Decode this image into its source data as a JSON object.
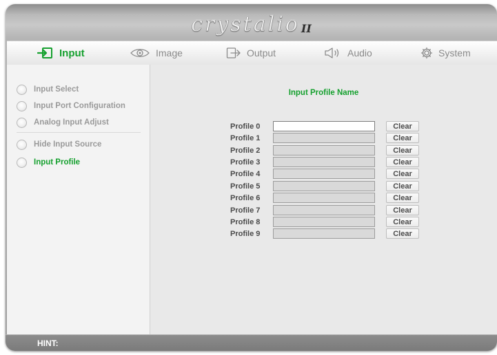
{
  "brand": {
    "name": "crystalio",
    "suffix": "II"
  },
  "nav": {
    "tabs": [
      {
        "label": "Input",
        "icon": "input-icon",
        "active": true
      },
      {
        "label": "Image",
        "icon": "eye-icon",
        "active": false
      },
      {
        "label": "Output",
        "icon": "output-icon",
        "active": false
      },
      {
        "label": "Audio",
        "icon": "speaker-icon",
        "active": false
      },
      {
        "label": "System",
        "icon": "gear-icon",
        "active": false
      }
    ]
  },
  "sidebar": {
    "items": [
      {
        "label": "Input Select",
        "active": false
      },
      {
        "label": "Input Port Configuration",
        "active": false
      },
      {
        "label": "Analog Input Adjust",
        "active": false
      },
      {
        "label": "Hide Input Source",
        "active": false
      },
      {
        "label": "Input Profile",
        "active": true
      }
    ]
  },
  "main": {
    "title": "Input Profile Name",
    "clear_label": "Clear",
    "profiles": [
      {
        "label": "Profile 0",
        "value": ""
      },
      {
        "label": "Profile 1",
        "value": ""
      },
      {
        "label": "Profile 2",
        "value": ""
      },
      {
        "label": "Profile 3",
        "value": ""
      },
      {
        "label": "Profile 4",
        "value": ""
      },
      {
        "label": "Profile 5",
        "value": ""
      },
      {
        "label": "Profile 6",
        "value": ""
      },
      {
        "label": "Profile 7",
        "value": ""
      },
      {
        "label": "Profile 8",
        "value": ""
      },
      {
        "label": "Profile 9",
        "value": ""
      }
    ]
  },
  "hint": {
    "label": "HINT:"
  },
  "colors": {
    "accent": "#15a02e",
    "inactive_text": "#8a8a8a",
    "panel_bg": "#e9e9e9"
  }
}
